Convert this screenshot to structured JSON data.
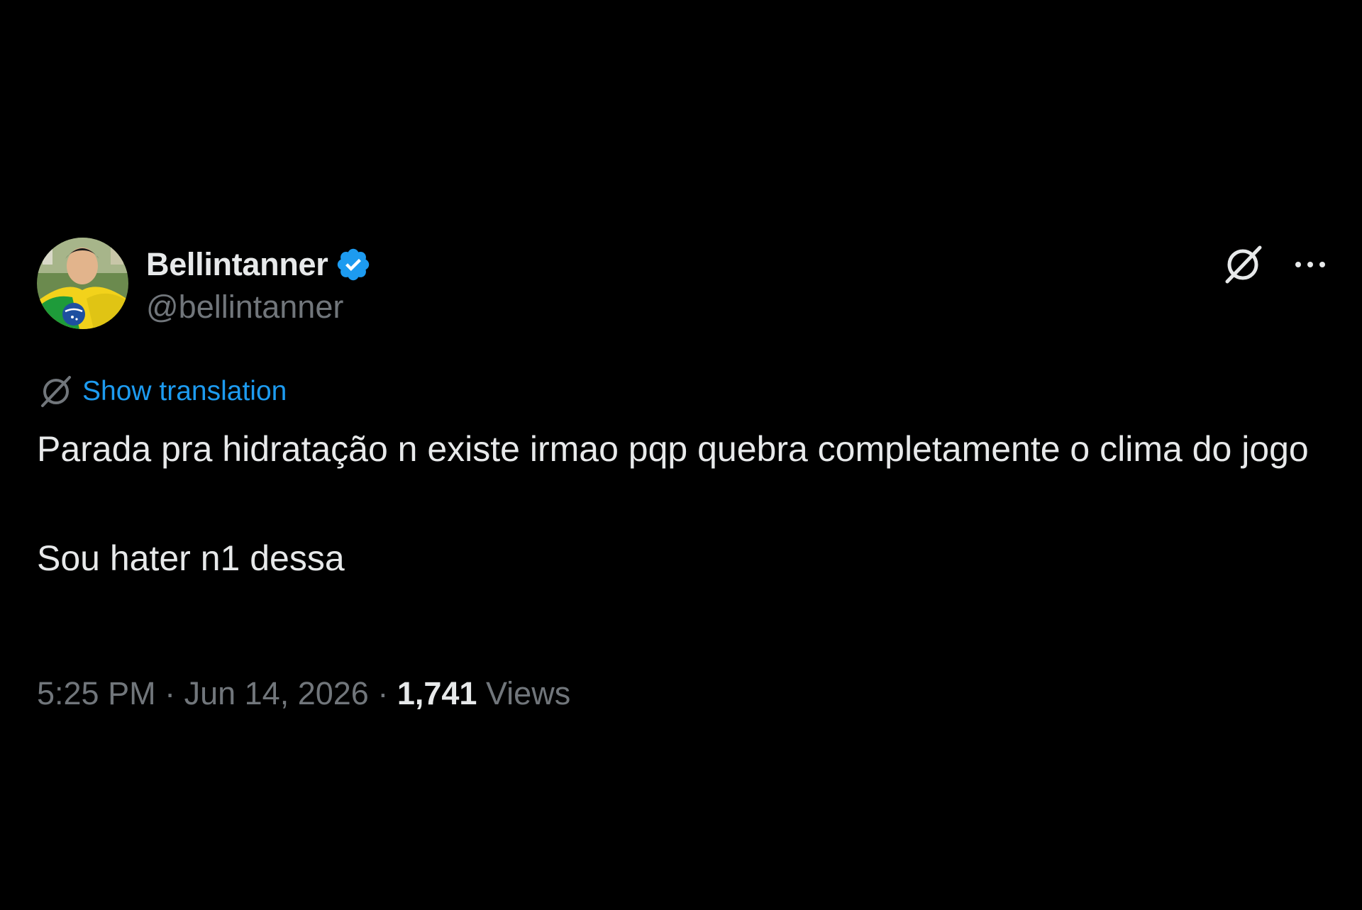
{
  "user": {
    "display_name": "Bellintanner",
    "handle": "@bellintanner",
    "verified": true,
    "avatar": "avatar-superman-brazil-flag"
  },
  "header": {
    "grok_icon": "grok-icon",
    "more_icon": "more-icon"
  },
  "translation": {
    "icon": "translate-icon",
    "label": "Show translation"
  },
  "tweet": {
    "line1": "Parada pra hidratação n existe irmao pqp quebra completamente o clima do jogo",
    "line2": "Sou hater n1 dessa"
  },
  "meta": {
    "time": "5:25 PM",
    "separator": " · ",
    "date": "Jun 14, 2026",
    "views_count": "1,741",
    "views_label": "Views"
  },
  "colors": {
    "background": "#000000",
    "text": "#e7e9ea",
    "secondary": "#71767b",
    "accent": "#1d9bf0"
  }
}
